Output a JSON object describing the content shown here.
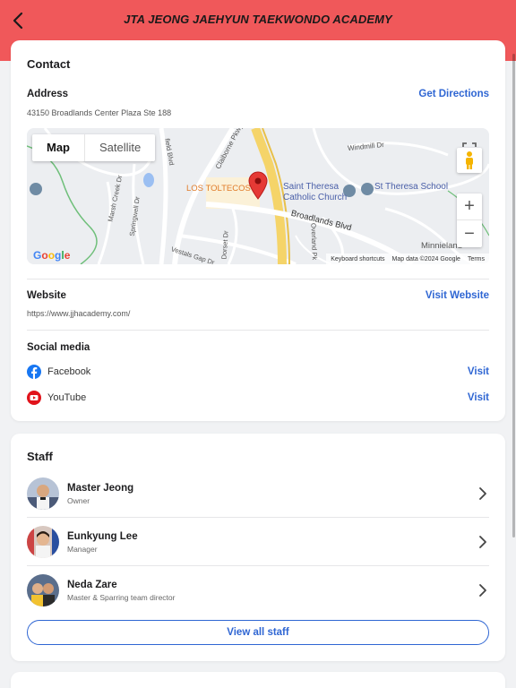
{
  "header": {
    "title": "JTA JEONG JAEHYUN TAEKWONDO ACADEMY",
    "back_icon": "chevron-left-icon",
    "background": "#f0585a"
  },
  "contact": {
    "title": "Contact",
    "address_label": "Address",
    "address": "43150 Broadlands Center Plaza Ste 188",
    "directions_label": "Get Directions",
    "map": {
      "mode_map": "Map",
      "mode_satellite": "Satellite",
      "zoom_in": "+",
      "zoom_out": "−",
      "logo": "Google",
      "footer": [
        "Keyboard shortcuts",
        "Map data ©2024 Google",
        "Terms"
      ],
      "labels": {
        "los_toltecos": "LOS TOLTECOS",
        "saint_theresa_line1": "Saint Theresa",
        "saint_theresa_line2": "Catholic Church",
        "st_theresa_school": "St Theresa School",
        "broadlands_blvd": "Broadlands Blvd",
        "windmill": "Windmill Dr",
        "claiborne": "Claiborne Pkwy",
        "minnieland": "Minnieland",
        "vestals_gap": "Vestals Gap Dr",
        "springwell": "Springwell Dr",
        "marsh_creek": "Marsh Creek Dr",
        "overland": "Overland Pk",
        "dorset": "Dorset Dr",
        "field_blvd": "field Blvd"
      }
    },
    "website_label": "Website",
    "website_url": "https://www.jjhacademy.com/",
    "visit_website_label": "Visit Website",
    "social_label": "Social media",
    "social": [
      {
        "name": "Facebook",
        "icon": "facebook-icon",
        "action": "Visit",
        "color": "#1877f2"
      },
      {
        "name": "YouTube",
        "icon": "youtube-icon",
        "action": "Visit",
        "color": "#e1131b"
      }
    ]
  },
  "staff": {
    "title": "Staff",
    "members": [
      {
        "name": "Master Jeong",
        "role": "Owner"
      },
      {
        "name": "Eunkyung Lee",
        "role": "Manager"
      },
      {
        "name": "Neda Zare",
        "role": "Master & Sparring team director"
      }
    ],
    "view_all_label": "View all staff"
  },
  "colors": {
    "accent": "#2f66d3",
    "header": "#f0585a"
  }
}
